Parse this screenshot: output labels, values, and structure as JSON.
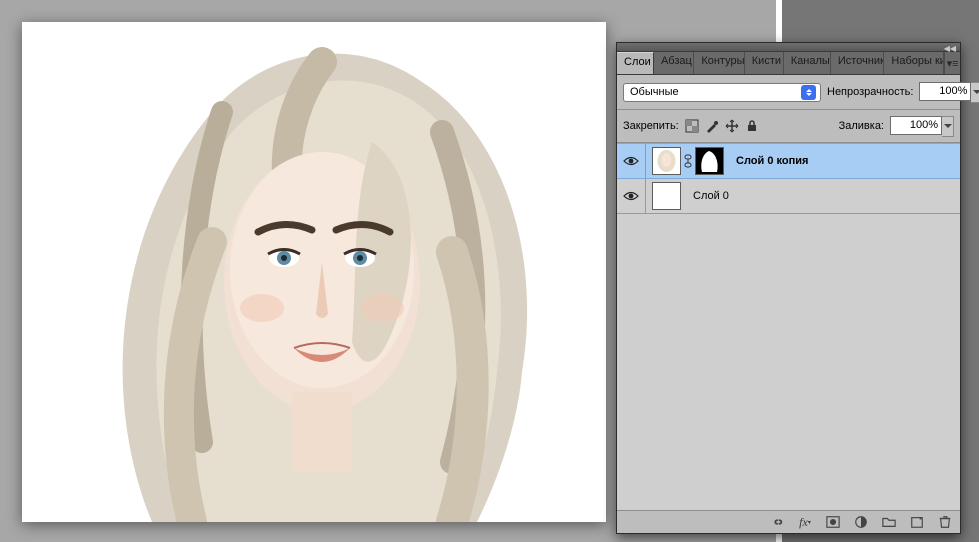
{
  "panel": {
    "tabs": [
      "Слои",
      "Абзац",
      "Контуры",
      "Кисти",
      "Каналы",
      "Источник",
      "Наборы ки"
    ],
    "active_tab_index": 0,
    "blend_mode": "Обычные",
    "opacity_label": "Непрозрачность:",
    "opacity_value": "100%",
    "lock_label": "Закрепить:",
    "fill_label": "Заливка:",
    "fill_value": "100%",
    "layers": [
      {
        "name": "Слой 0 копия",
        "visible": true,
        "selected": true,
        "has_mask": true
      },
      {
        "name": "Слой 0",
        "visible": true,
        "selected": false,
        "has_mask": false
      }
    ]
  }
}
